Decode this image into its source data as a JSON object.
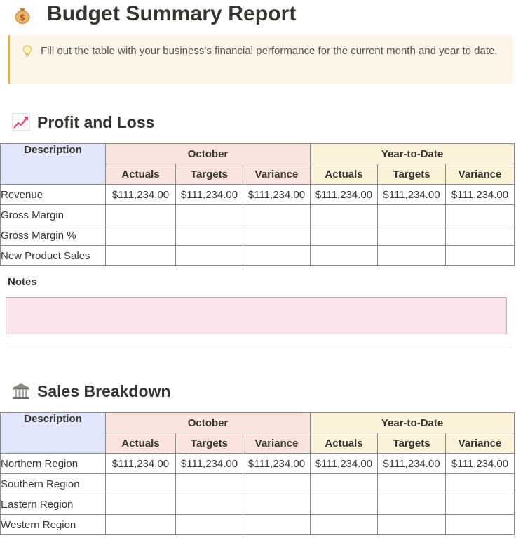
{
  "page": {
    "title": "Budget Summary Report",
    "title_icon": "money-bag-icon"
  },
  "callout": {
    "icon": "lightbulb-icon",
    "text": "Fill out the table with your business's financial performance for the current month and year to date."
  },
  "sections": [
    {
      "heading": "Profit and Loss",
      "icon": "chart-increasing-icon",
      "table": {
        "description_header": "Description",
        "group_headers": [
          "October",
          "Year-to-Date"
        ],
        "sub_headers": [
          "Actuals",
          "Targets",
          "Variance",
          "Actuals",
          "Targets",
          "Variance"
        ],
        "rows": [
          {
            "label": "Revenue",
            "cells": [
              "$111,234.00",
              "$111,234.00",
              "$111,234.00",
              "$111,234.00",
              "$111,234.00",
              "$111,234.00"
            ]
          },
          {
            "label": "Gross Margin",
            "cells": [
              "",
              "",
              "",
              "",
              "",
              ""
            ]
          },
          {
            "label": "Gross Margin %",
            "cells": [
              "",
              "",
              "",
              "",
              "",
              ""
            ]
          },
          {
            "label": "New Product Sales",
            "cells": [
              "",
              "",
              "",
              "",
              "",
              ""
            ]
          }
        ]
      },
      "notes_label": "Notes",
      "notes_value": ""
    },
    {
      "heading": "Sales Breakdown",
      "icon": "bank-icon",
      "table": {
        "description_header": "Description",
        "group_headers": [
          "October",
          "Year-to-Date"
        ],
        "sub_headers": [
          "Actuals",
          "Targets",
          "Variance",
          "Actuals",
          "Targets",
          "Variance"
        ],
        "rows": [
          {
            "label": "Northern Region",
            "cells": [
              "$111,234.00",
              "$111,234.00",
              "$111,234.00",
              "$111,234.00",
              "$111,234.00",
              "$111,234.00"
            ]
          },
          {
            "label": "Southern Region",
            "cells": [
              "",
              "",
              "",
              "",
              "",
              ""
            ]
          },
          {
            "label": "Eastern Region",
            "cells": [
              "",
              "",
              "",
              "",
              "",
              ""
            ]
          },
          {
            "label": "Western Region",
            "cells": [
              "",
              "",
              "",
              "",
              "",
              ""
            ]
          }
        ]
      }
    }
  ],
  "colors": {
    "description_header_bg": "#e1e6fb",
    "october_header_bg": "#f8e4dc",
    "ytd_header_bg": "#fcf2d9",
    "callout_bg": "#fdf6e8",
    "callout_accent": "#f2b01e",
    "notes_bg": "#fbe3ee"
  }
}
